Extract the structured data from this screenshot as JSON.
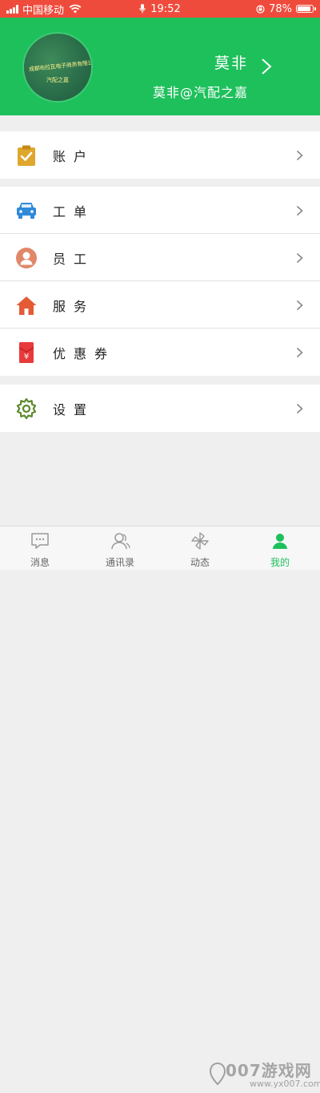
{
  "status_bar": {
    "carrier": "中国移动",
    "time": "19:52",
    "battery": "78%",
    "battery_level": 0.78
  },
  "header": {
    "name": "莫非",
    "subtitle": "莫非@汽配之嘉",
    "avatar_text": [
      "成都布拉瓦电子商务有限公司",
      "汽配之嘉"
    ]
  },
  "menu_groups": [
    {
      "items": [
        {
          "label": "账户",
          "icon": "clipboard-check-icon",
          "color": "#e0a72d"
        }
      ]
    },
    {
      "items": [
        {
          "label": "工单",
          "icon": "car-icon",
          "color": "#2f8ad8"
        },
        {
          "label": "员工",
          "icon": "person-icon",
          "color": "#e0876a"
        },
        {
          "label": "服务",
          "icon": "home-icon",
          "color": "#e55a36"
        },
        {
          "label": "优惠券",
          "icon": "coupon-icon",
          "color": "#e83a3a"
        }
      ]
    },
    {
      "items": [
        {
          "label": "设置",
          "icon": "gear-icon",
          "color": "#5b8a2c"
        }
      ]
    }
  ],
  "tabs": [
    {
      "label": "消息",
      "icon": "message-icon"
    },
    {
      "label": "通讯录",
      "icon": "contacts-icon"
    },
    {
      "label": "动态",
      "icon": "pinwheel-icon"
    },
    {
      "label": "我的",
      "icon": "profile-icon",
      "active": true
    }
  ],
  "watermark": {
    "brand": "007游戏网",
    "domain": "www.yx007.com"
  },
  "colors": {
    "primary": "#1ec05c",
    "status_bar": "#ef4b3c"
  }
}
